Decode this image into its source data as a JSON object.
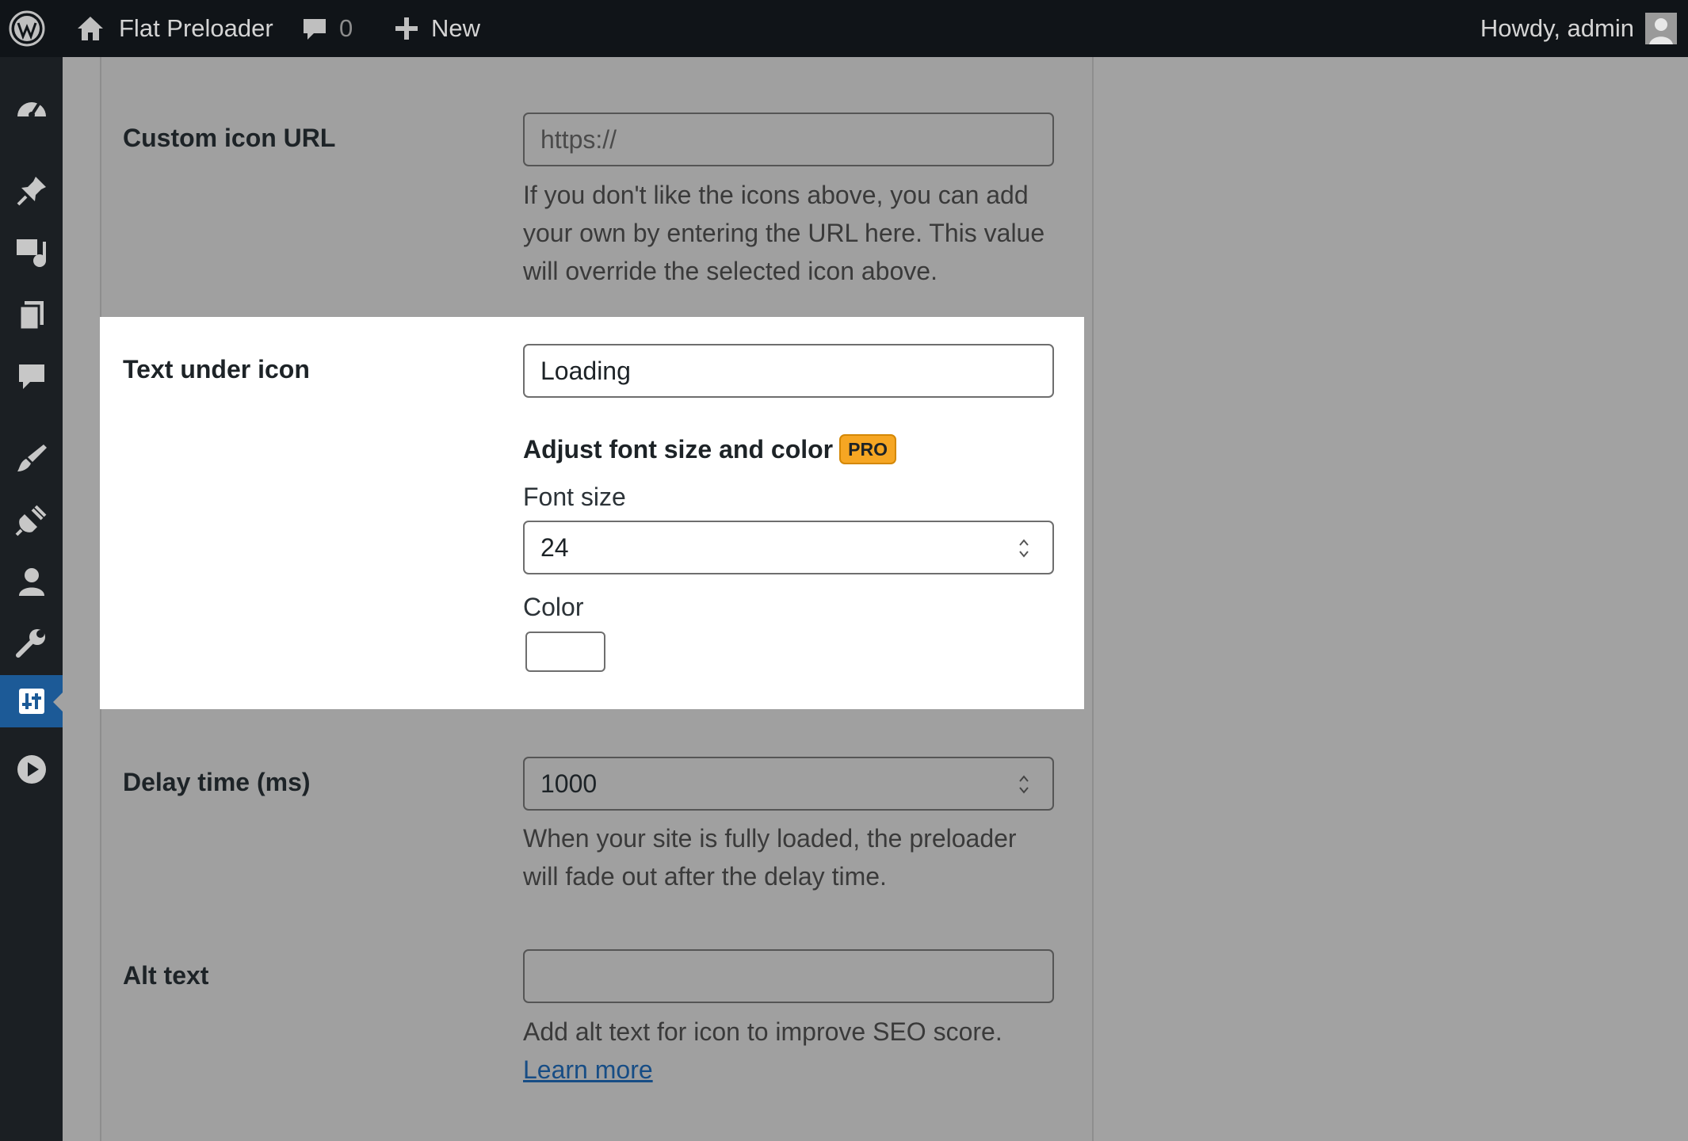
{
  "adminbar": {
    "site_name": "Flat Preloader",
    "comments_count": "0",
    "new_label": "New",
    "howdy": "Howdy, admin"
  },
  "sidebar": {
    "items": [
      {
        "icon": "dashboard-icon"
      },
      {
        "icon": "pin-icon"
      },
      {
        "icon": "media-icon"
      },
      {
        "icon": "pages-icon"
      },
      {
        "icon": "comments-icon"
      },
      {
        "icon": "appearance-icon"
      },
      {
        "icon": "plugins-icon"
      },
      {
        "icon": "users-icon"
      },
      {
        "icon": "tools-icon"
      },
      {
        "icon": "settings-icon",
        "current": true
      },
      {
        "icon": "play-icon"
      }
    ]
  },
  "fields": {
    "custom_icon": {
      "label": "Custom icon URL",
      "placeholder": "https://",
      "desc": [
        "If you don't like the icons above, you can add",
        "your own by entering the URL here. This value",
        "will override the selected icon above."
      ]
    },
    "text_under_icon": {
      "label": "Text under icon",
      "value": "Loading",
      "adjust_heading": "Adjust font size and color",
      "pro_badge": "PRO",
      "font_size_label": "Font size",
      "font_size_value": "24",
      "color_label": "Color",
      "color_value": "#ffffff"
    },
    "delay": {
      "label": "Delay time (ms)",
      "value": "1000",
      "desc": [
        "When your site is fully loaded, the preloader",
        "will fade out after the delay time."
      ]
    },
    "alt_text": {
      "label": "Alt text",
      "value": "",
      "desc": "Add alt text for icon to improve SEO score.",
      "link": "Learn more"
    }
  },
  "colors": {
    "adminbar_bg": "#101418",
    "sidebar_bg": "#1b1f23",
    "current_menu": "#1c5a97",
    "pro_badge": "#f6a623",
    "link": "#174d85"
  }
}
